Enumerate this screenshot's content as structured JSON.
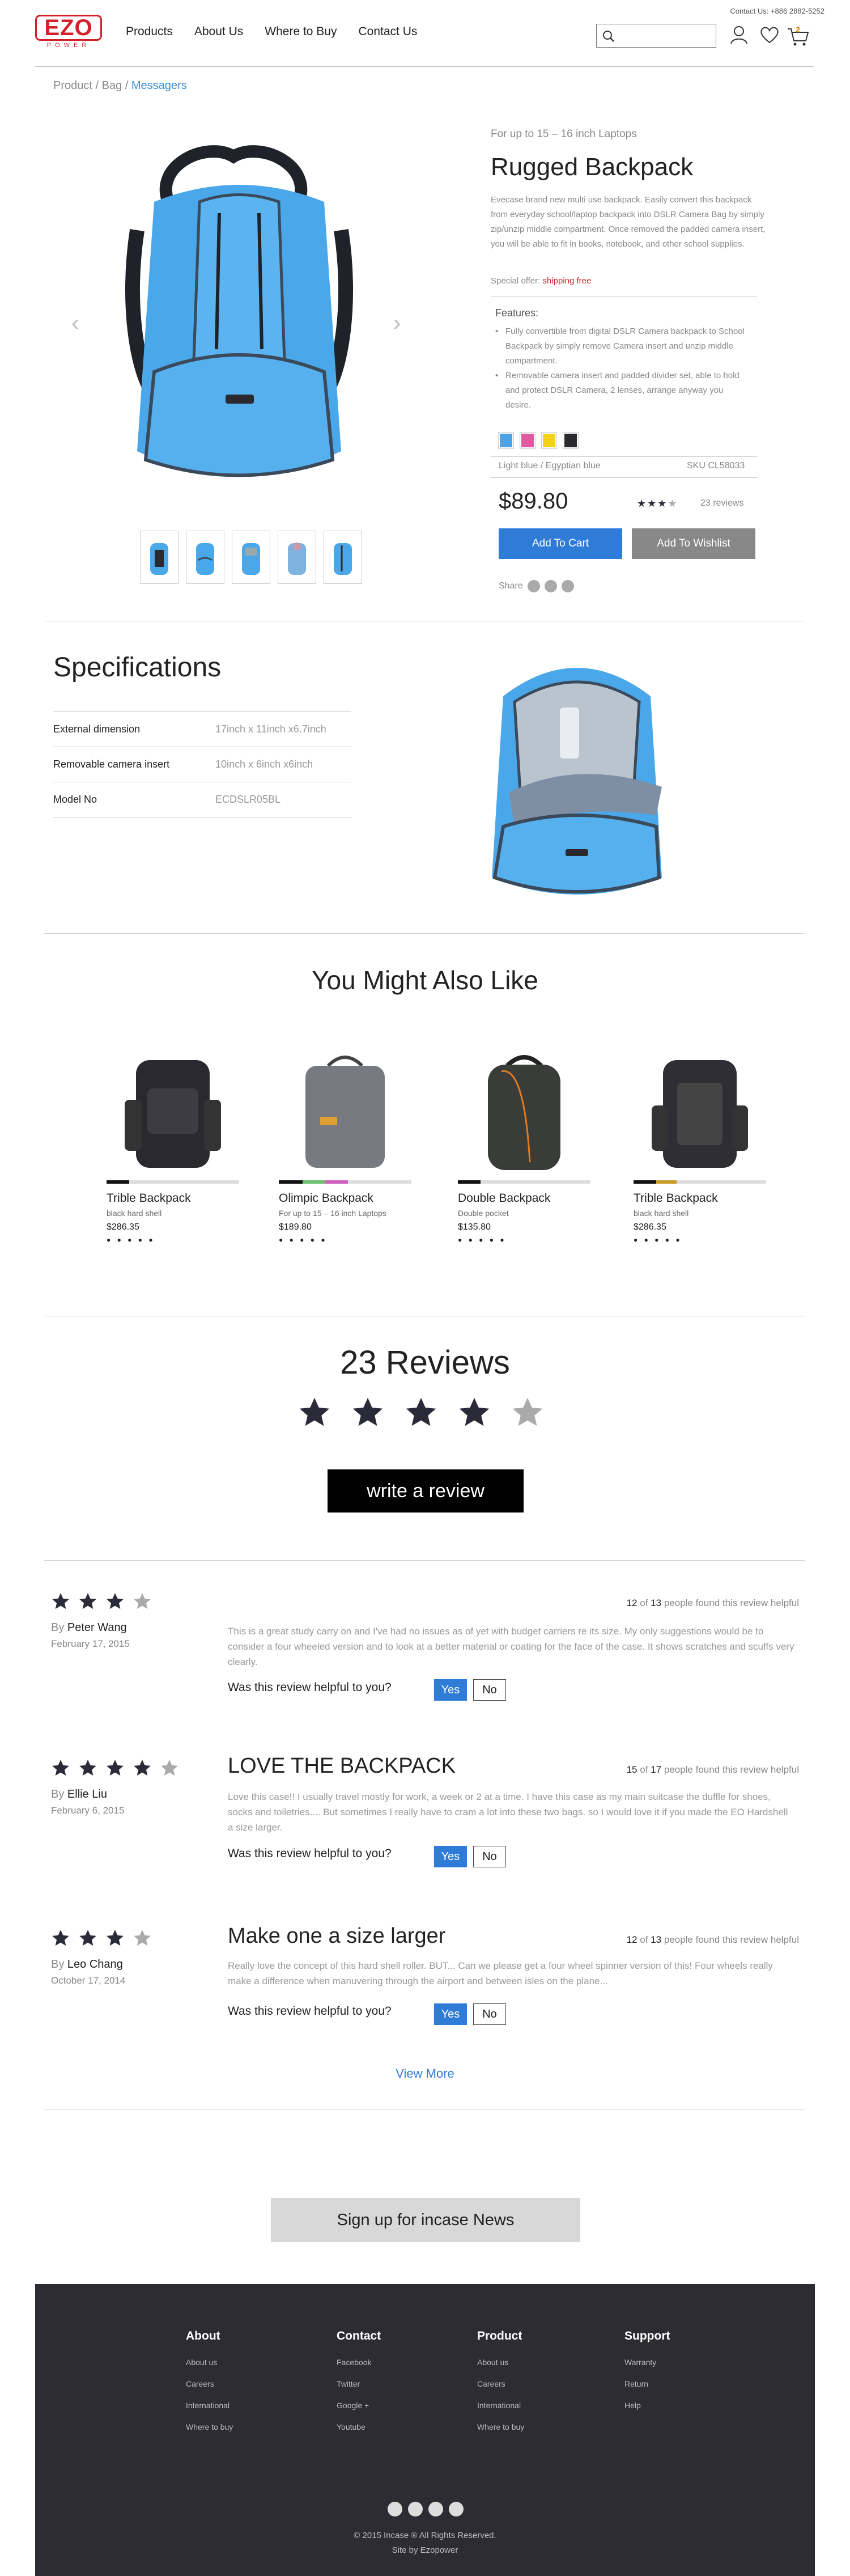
{
  "header": {
    "contact": "Contact Us: +886 2882-5252",
    "logo_text": "EZO",
    "logo_sub": "POWER",
    "nav": [
      "Products",
      "About Us",
      "Where to Buy",
      "Contact Us"
    ],
    "search_placeholder": "",
    "cart_count": "2"
  },
  "breadcrumb": {
    "items": [
      "Product",
      "Bag"
    ],
    "active": "Messagers"
  },
  "product": {
    "subtitle": "For up to 15 – 16 inch Laptops",
    "title": "Rugged Backpack",
    "description": "Evecase brand new multi use backpack. Easily convert this backpack from everyday school/laptop backpack into DSLR Camera Bag by simply zip/unzip middle compartment. Once removed the padded camera insert, you will be able to fit in books, notebook, and other school supplies.",
    "offer_label": "Special offer:",
    "offer_value": "shipping free",
    "features_title": "Features:",
    "features": [
      "Fully convertible from digital DSLR Camera backpack to School Backpack by simply remove Camera insert and unzip middle compartment.",
      "Removable camera insert and padded divider set, able to hold and protect DSLR Camera, 2 lenses, arrange anyway you desire."
    ],
    "swatches": [
      "#4da3e8",
      "#e05aa0",
      "#f4d21a",
      "#2a2a2e"
    ],
    "color_name": "Light blue / Egyptian blue",
    "sku": "SKU CL58033",
    "price": "$89.80",
    "rating": 3,
    "reviews_count": "23 reviews",
    "add_to_cart": "Add To Cart",
    "add_to_wishlist": "Add To Wishlist",
    "share_label": "Share"
  },
  "specs": {
    "title": "Specifications",
    "rows": [
      {
        "label": "External dimension",
        "value": "17inch x 11inch x6.7inch"
      },
      {
        "label": "Removable camera insert",
        "value": "10inch x 6inch x6inch"
      },
      {
        "label": "Model No",
        "value": "ECDSLR05BL"
      }
    ]
  },
  "related": {
    "title": "You Might Also Like",
    "items": [
      {
        "name": "Trible Backpack",
        "sub": "black hard shell",
        "price": "$286.35",
        "rating": "● ● ● ● ●"
      },
      {
        "name": "Olimpic Backpack",
        "sub": "For up to 15 – 16 inch Laptops",
        "price": "$189.80",
        "rating": "● ● ● ● ●"
      },
      {
        "name": "Double Backpack",
        "sub": "Double pocket",
        "price": "$135.80",
        "rating": "● ● ● ● ●"
      },
      {
        "name": "Trible Backpack",
        "sub": "black hard shell",
        "price": "$286.35",
        "rating": "● ● ● ● ●"
      }
    ]
  },
  "reviews": {
    "title": "23 Reviews",
    "rating": 4,
    "write_button": "write a review",
    "helpful_question": "Was this review helpful to you?",
    "yes": "Yes",
    "no": "No",
    "view_more": "View More",
    "by": "By",
    "helpful_mid": "of",
    "helpful_end": "people found this review helpful",
    "items": [
      {
        "stars": 3,
        "author": "Peter Wang",
        "date": "February 17, 2015",
        "heading": "",
        "found": "12",
        "total": "13",
        "body": "This is a great study carry on and I've had no issues as of yet with budget carriers re its size. My only suggestions would be to consider a four wheeled version and to look at a better material or coating for the face of the case. It shows scratches and scuffs very clearly."
      },
      {
        "stars": 4,
        "author": "Ellie Liu",
        "date": "February 6, 2015",
        "heading": "LOVE THE BACKPACK",
        "found": "15",
        "total": "17",
        "body": "Love this case!! I usually travel mostly for work, a week or 2 at a time. I have this case as my main suitcase the duffle for shoes, socks and toiletries.... But sometimes I really have to cram a lot into these two bags. so I would love it if you made the EO Hardshell a size larger."
      },
      {
        "stars": 3,
        "author": "Leo Chang",
        "date": "October 17, 2014",
        "heading": "Make one a size larger",
        "found": "12",
        "total": "13",
        "body": "Really love the concept of this hard shell roller. BUT... Can we please get a four wheel spinner version of this! Four wheels really make a difference when manuvering through the airport and between isles on the plane..."
      }
    ]
  },
  "signup": "Sign up for incase News",
  "footer": {
    "columns": [
      {
        "title": "About",
        "links": [
          "About us",
          "Careers",
          "International",
          "Where to buy"
        ]
      },
      {
        "title": "Contact",
        "links": [
          "Facebook",
          "Twitter",
          "Google +",
          "Youtube"
        ]
      },
      {
        "title": "Product",
        "links": [
          "About us",
          "Careers",
          "International",
          "Where to buy"
        ]
      },
      {
        "title": "Support",
        "links": [
          "Warranty",
          "Return",
          "Help"
        ]
      }
    ],
    "copyright": "© 2015 Incase ® All Rights Reserved.",
    "credit": "Site by Ezopower"
  }
}
